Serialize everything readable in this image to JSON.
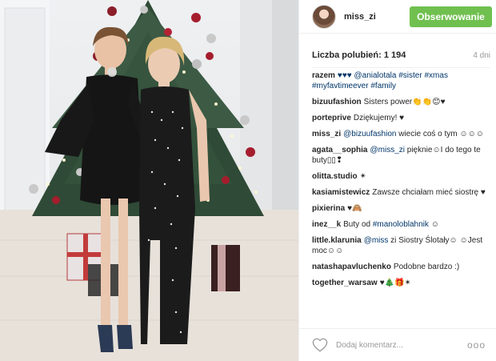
{
  "post": {
    "image_alt": "",
    "author": {
      "username": "miss_zi",
      "follow_label": "Obserwowanie"
    },
    "likes_label": "Liczba polubień: 1 194",
    "age_label": "4 dni",
    "comment_placeholder": "Dodaj komentarz...",
    "more_label": "ooo",
    "comments": [
      {
        "author": "razem",
        "text": "♥♥♥ @anialotala #sister #xmas #myfavtimeever #family"
      },
      {
        "author": "bizuufashion",
        "text": "Sisters power👏👏😊♥"
      },
      {
        "author": "porteprive",
        "text": "Dziękujemy! ♥"
      },
      {
        "author": "miss_zi",
        "text": "@bizuufashion wiecie coś o tym ☺☺☺"
      },
      {
        "author": "agata__sophia",
        "text": "@miss_zi pięknie☺I do tego te buty▯▯❢"
      },
      {
        "author": "olitta.studio",
        "text": "✴"
      },
      {
        "author": "kasiamistewicz",
        "text": "Zawsze chciałam mieć siostrę ♥"
      },
      {
        "author": "pixierina",
        "text": "♥🙈"
      },
      {
        "author": "inez__k",
        "text": "Buty od #manoloblahnik ☺"
      },
      {
        "author": "little.klarunia",
        "text": "@miss zi Siostry Ślotały☺ ☺Jest moc☺☺"
      },
      {
        "author": "natashapavluchenko",
        "text": "Podobne bardzo :)"
      },
      {
        "author": "together_warsaw",
        "text": "♥🎄🎁✴"
      }
    ]
  },
  "icons": {
    "like": "heart-outline-icon",
    "more": "more-options-icon"
  },
  "colors": {
    "follow_button": "#70c050",
    "link": "#003569",
    "muted": "#999999",
    "border": "#efefef"
  }
}
